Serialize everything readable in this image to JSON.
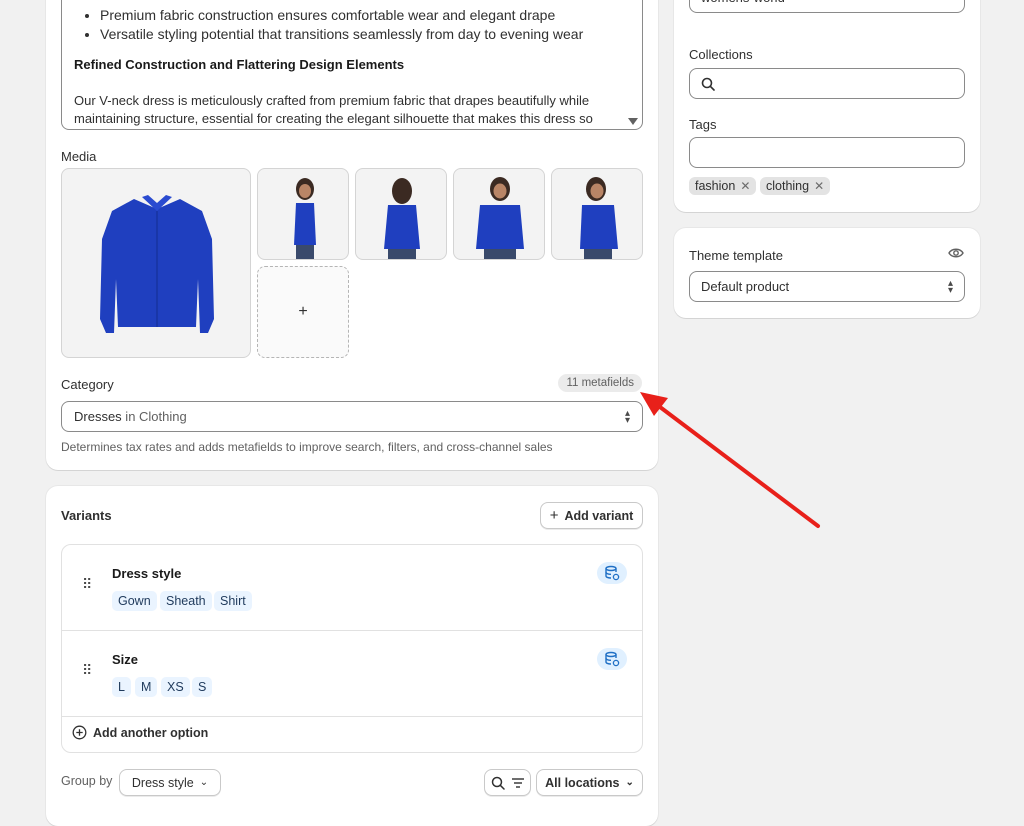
{
  "description": {
    "bullets": [
      "Premium fabric construction ensures comfortable wear and elegant drape",
      "Versatile styling potential that transitions seamlessly from day to evening wear"
    ],
    "heading": "Refined Construction and Flattering Design Elements",
    "paragraph": "Our V-neck dress is meticulously crafted from premium fabric that drapes beautifully while maintaining structure, essential for creating the elegant silhouette that makes this dress so"
  },
  "media": {
    "label": "Media",
    "add_symbol": "+"
  },
  "category": {
    "label": "Category",
    "metafields_badge": "11 metafields",
    "value_main": "Dresses",
    "value_suffix": " in Clothing",
    "help": "Determines tax rates and adds metafields to improve search, filters, and cross-channel sales"
  },
  "organization": {
    "vendor_value": "womens-world",
    "collections_label": "Collections",
    "tags_label": "Tags",
    "tags": [
      "fashion",
      "clothing"
    ]
  },
  "theme": {
    "label": "Theme template",
    "value": "Default product"
  },
  "variants": {
    "title": "Variants",
    "add_variant": "Add variant",
    "options": [
      {
        "name": "Dress style",
        "values": [
          "Gown",
          "Sheath",
          "Shirt"
        ]
      },
      {
        "name": "Size",
        "values": [
          "L",
          "M",
          "XS",
          "S"
        ]
      }
    ],
    "add_another_option": "Add another option",
    "group_by_label": "Group by",
    "group_by_value": "Dress style",
    "locations": "All locations"
  },
  "colors": {
    "shirt_blue": "#1f3fbf",
    "annotation_red": "#e8201a",
    "chip_bg": "#eaf4ff"
  }
}
